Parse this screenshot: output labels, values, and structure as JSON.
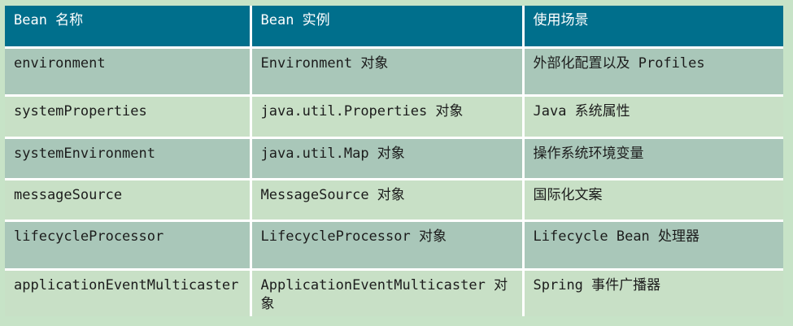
{
  "table": {
    "headers": [
      "Bean 名称",
      "Bean 实例",
      "使用场景"
    ],
    "rows": [
      [
        "environment",
        "Environment 对象",
        "外部化配置以及 Profiles"
      ],
      [
        "systemProperties",
        "java.util.Properties 对象",
        "Java 系统属性"
      ],
      [
        "systemEnvironment",
        "java.util.Map 对象",
        "操作系统环境变量"
      ],
      [
        "messageSource",
        "MessageSource 对象",
        "国际化文案"
      ],
      [
        "lifecycleProcessor",
        "LifecycleProcessor 对象",
        "Lifecycle Bean 处理器"
      ],
      [
        "applicationEventMulticaster",
        "ApplicationEventMulticaster 对象",
        "Spring 事件广播器"
      ]
    ]
  },
  "colors": {
    "page_background": "#c7e3c7",
    "header_background": "#006f8c",
    "header_text": "#ffffff",
    "row_odd_background": "#a9c7b9",
    "row_even_background": "#c8e0c6",
    "cell_text": "#1c1c1c",
    "grid_lines": "#ffffff"
  }
}
